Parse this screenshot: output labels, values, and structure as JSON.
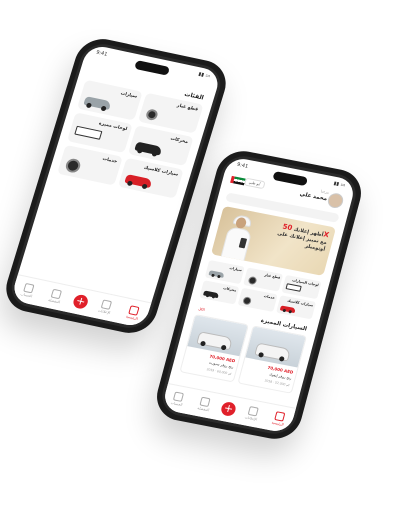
{
  "back_phone": {
    "status_time": "9:41",
    "section_title": "الفئات",
    "tiles": [
      {
        "label": "سيارات",
        "graphic": "car",
        "color": "#9aa3a8"
      },
      {
        "label": "قطع غيار",
        "graphic": "parts",
        "color": "#444444"
      },
      {
        "label": "لوحات مميزة",
        "graphic": "plate",
        "color": "#333333"
      },
      {
        "label": "محركات",
        "graphic": "car",
        "color": "#222222"
      },
      {
        "label": "خدمات",
        "graphic": "wheel",
        "color": "#2a2a2a"
      },
      {
        "label": "سيارات كلاسيك",
        "graphic": "car",
        "color": "#d81f26"
      }
    ],
    "tabs": [
      {
        "label": "الرئيسية",
        "icon": "home-icon",
        "active": true
      },
      {
        "label": "الإعلانات",
        "icon": "grid-icon",
        "active": false
      },
      {
        "label": "+",
        "icon": "add-icon",
        "active": false
      },
      {
        "label": "المفضلة",
        "icon": "heart-icon",
        "active": false
      },
      {
        "label": "الحساب",
        "icon": "user-icon",
        "active": false
      }
    ]
  },
  "front_phone": {
    "status_time": "9:41",
    "greeting": "مرحبا",
    "user_name": "محمد علي",
    "location_chip": "أبو ظبي",
    "banner": {
      "line1": "أظهر إعلانك",
      "highlight": "50X",
      "line2": "مع تمييز إعلانك على",
      "line3": "أوتوميلز"
    },
    "categories": [
      {
        "label": "سيارات",
        "graphic": "car",
        "color": "#9aa3a8"
      },
      {
        "label": "قطع غيار",
        "graphic": "parts",
        "color": "#444444"
      },
      {
        "label": "لوحات السيارات",
        "graphic": "plate",
        "color": "#333333"
      },
      {
        "label": "محركات",
        "graphic": "car",
        "color": "#222222"
      },
      {
        "label": "خدمات",
        "graphic": "wheel",
        "color": "#2a2a2a"
      },
      {
        "label": "سيارات كلاسيك",
        "graphic": "car",
        "color": "#d81f26"
      }
    ],
    "featured_title": "السيارات المميزة",
    "featured_see_all": "الكل",
    "listings": [
      {
        "price": "70,000 AED",
        "name": "رنج روفر سبورت",
        "meta": "2019 · 60,000 كم",
        "color": "#f4f4f4"
      },
      {
        "price": "70,000 AED",
        "name": "رنج روفر إيفوك",
        "meta": "2018 · 52,000 كم",
        "color": "#f4f4f4"
      }
    ],
    "tabs": [
      {
        "label": "الرئيسية",
        "icon": "home-icon",
        "active": true
      },
      {
        "label": "الإعلانات",
        "icon": "grid-icon",
        "active": false
      },
      {
        "label": "+",
        "icon": "add-icon",
        "active": false
      },
      {
        "label": "المفضلة",
        "icon": "heart-icon",
        "active": false
      },
      {
        "label": "الحساب",
        "icon": "user-icon",
        "active": false
      }
    ]
  },
  "colors": {
    "accent": "#e0202a",
    "phone_body": "#1b1b1b",
    "background": "#ffffff"
  }
}
